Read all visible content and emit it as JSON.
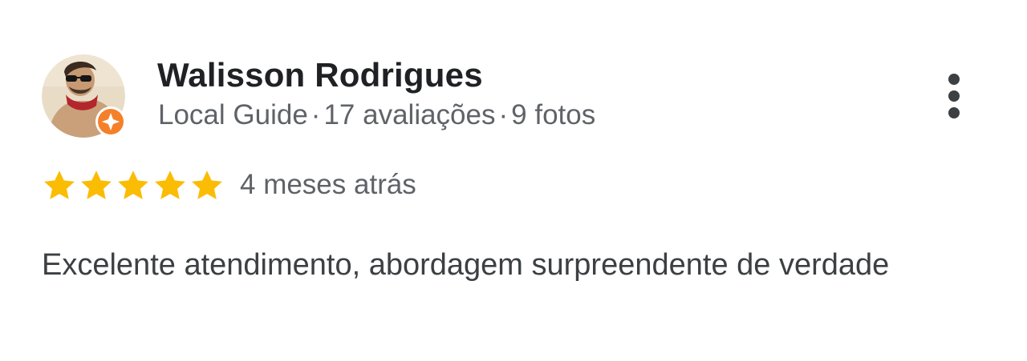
{
  "reviewer": {
    "name": "Walisson Rodrigues",
    "badge": "Local Guide",
    "reviews_count": "17 avaliações",
    "photos_count": "9 fotos",
    "separator": "·",
    "avatar_icon": "user-avatar-photo",
    "badge_icon": "local-guide-badge-icon"
  },
  "review": {
    "rating": 5,
    "rating_max": 5,
    "date": "4 meses atrás",
    "text": "Excelente atendimento, abordagem surpreendente de verdade"
  },
  "menu": {
    "icon": "more-vert-icon"
  },
  "colors": {
    "star": "#FBBC04",
    "badge": "#F4802A",
    "name_text": "#202124",
    "secondary_text": "#5f6368",
    "body_text": "#3c4043"
  }
}
